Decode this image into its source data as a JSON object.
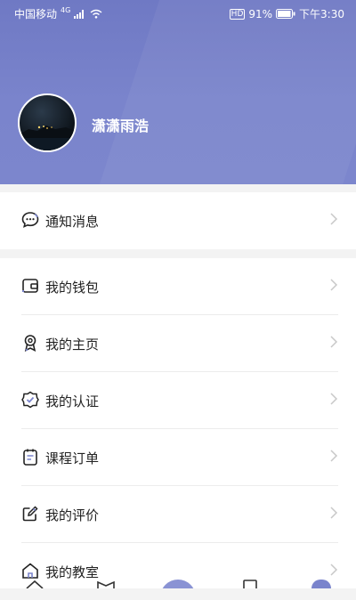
{
  "status_bar": {
    "carrier": "中国移动",
    "network": "4G",
    "battery": "91%",
    "time": "下午3:30",
    "hd_badge": "HD"
  },
  "profile": {
    "name": "潇潇雨浩"
  },
  "menu_top": [
    {
      "label": "通知消息",
      "icon": "chat-bubble-icon"
    }
  ],
  "menu_main": [
    {
      "label": "我的钱包",
      "icon": "wallet-icon"
    },
    {
      "label": "我的主页",
      "icon": "badge-icon"
    },
    {
      "label": "我的认证",
      "icon": "verified-shield-icon"
    },
    {
      "label": "课程订单",
      "icon": "clipboard-icon"
    },
    {
      "label": "我的评价",
      "icon": "edit-square-icon"
    },
    {
      "label": "我的教室",
      "icon": "classroom-icon"
    }
  ],
  "colors": {
    "header": "#7a84cc",
    "accent": "#6f79c4",
    "text": "#222222",
    "chevron": "#c8c8c8"
  }
}
